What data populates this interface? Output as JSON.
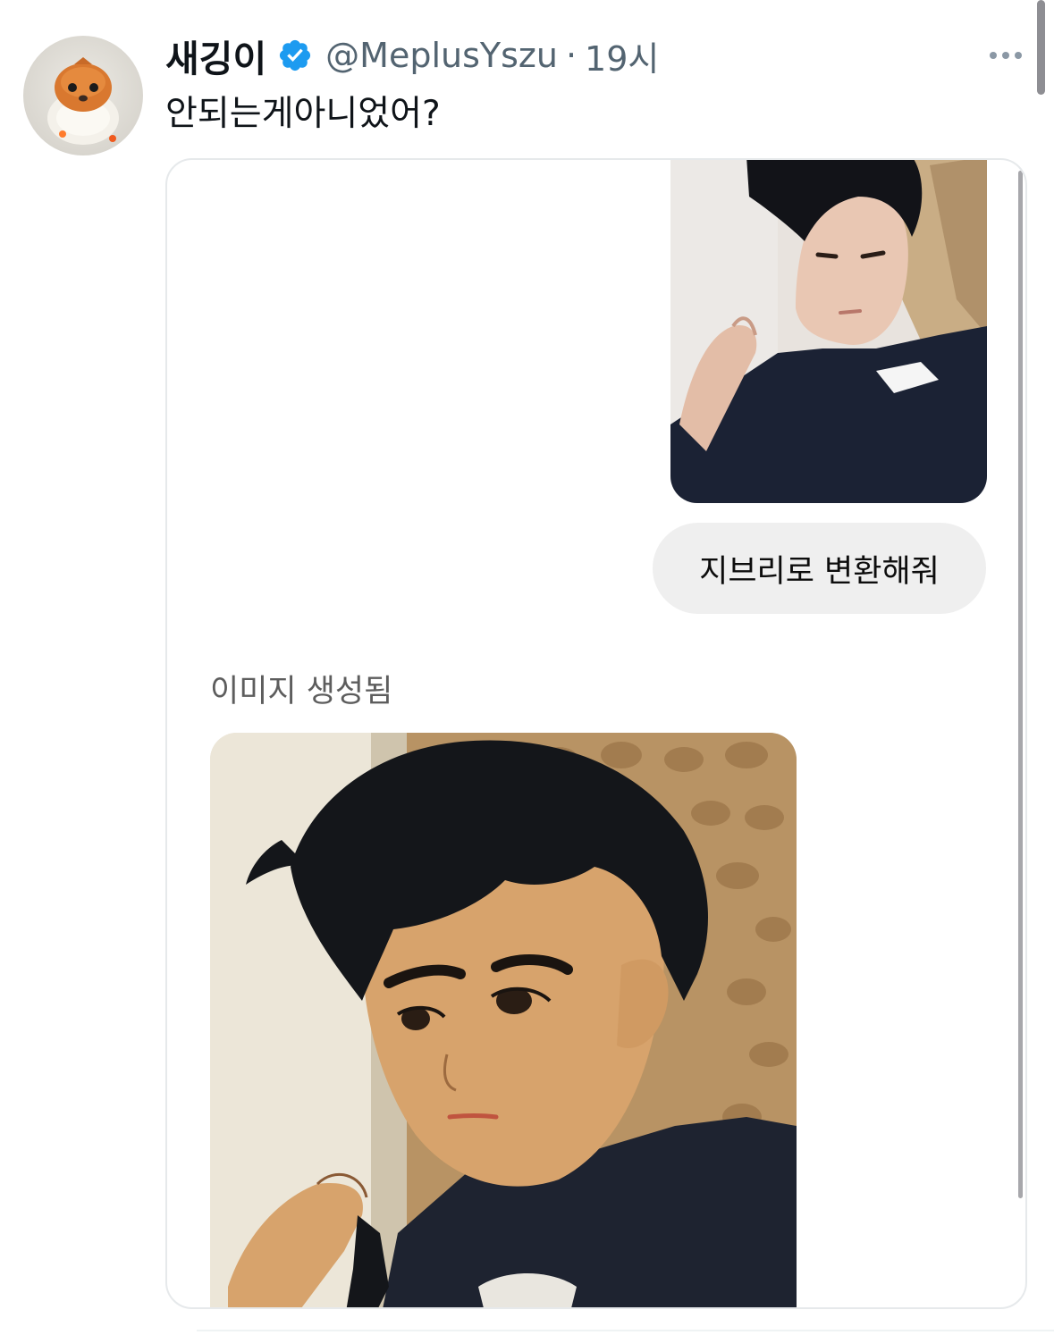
{
  "tweet": {
    "display_name": "새깅이",
    "handle": "@MeplusYszu",
    "separator": "·",
    "time": "19시",
    "text": "안되는게아니었어?",
    "verified_color": "#1d9bf0"
  },
  "chat": {
    "user_message": "지브리로 변환해줘",
    "status_label": "이미지 생성됨"
  },
  "icons": {
    "verified": "verified-badge-icon",
    "more": "more-dots-icon"
  }
}
